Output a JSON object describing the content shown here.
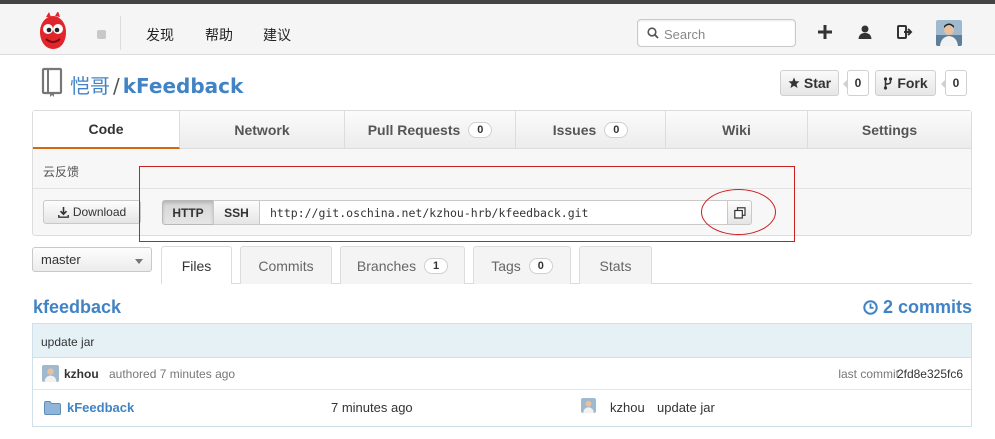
{
  "nav": {
    "links": [
      "发现",
      "帮助",
      "建议"
    ],
    "search_placeholder": "Search"
  },
  "repo": {
    "owner": "恺哥",
    "separator": "/",
    "name": "kFeedback",
    "star_label": "Star",
    "star_count": "0",
    "fork_label": "Fork",
    "fork_count": "0",
    "description": "云反馈"
  },
  "tabs": [
    {
      "label": "Code"
    },
    {
      "label": "Network"
    },
    {
      "label": "Pull Requests",
      "count": "0"
    },
    {
      "label": "Issues",
      "count": "0"
    },
    {
      "label": "Wiki"
    },
    {
      "label": "Settings"
    }
  ],
  "clone": {
    "download_label": "Download",
    "http_label": "HTTP",
    "ssh_label": "SSH",
    "url": "http://git.oschina.net/kzhou-hrb/kfeedback.git"
  },
  "branch": {
    "selected": "master"
  },
  "subtabs": [
    {
      "label": "Files"
    },
    {
      "label": "Commits"
    },
    {
      "label": "Branches",
      "count": "1"
    },
    {
      "label": "Tags",
      "count": "0"
    },
    {
      "label": "Stats"
    }
  ],
  "files": {
    "repo_name": "kfeedback",
    "commits_label": "2 commits",
    "last_commit_message": "update jar",
    "author": "kzhou",
    "authored_text": "authored 7 minutes ago",
    "last_commit_label": "last commit",
    "commit_hash": "2fd8e325fc6",
    "rows": [
      {
        "name": "kFeedback",
        "age": "7 minutes ago",
        "author": "kzhou",
        "message": "update jar"
      }
    ]
  },
  "colors": {
    "link": "#4183c4",
    "active_tab_accent": "#d26911",
    "annotation": "#cc2020",
    "commit_bar": "#e6f1f6"
  }
}
